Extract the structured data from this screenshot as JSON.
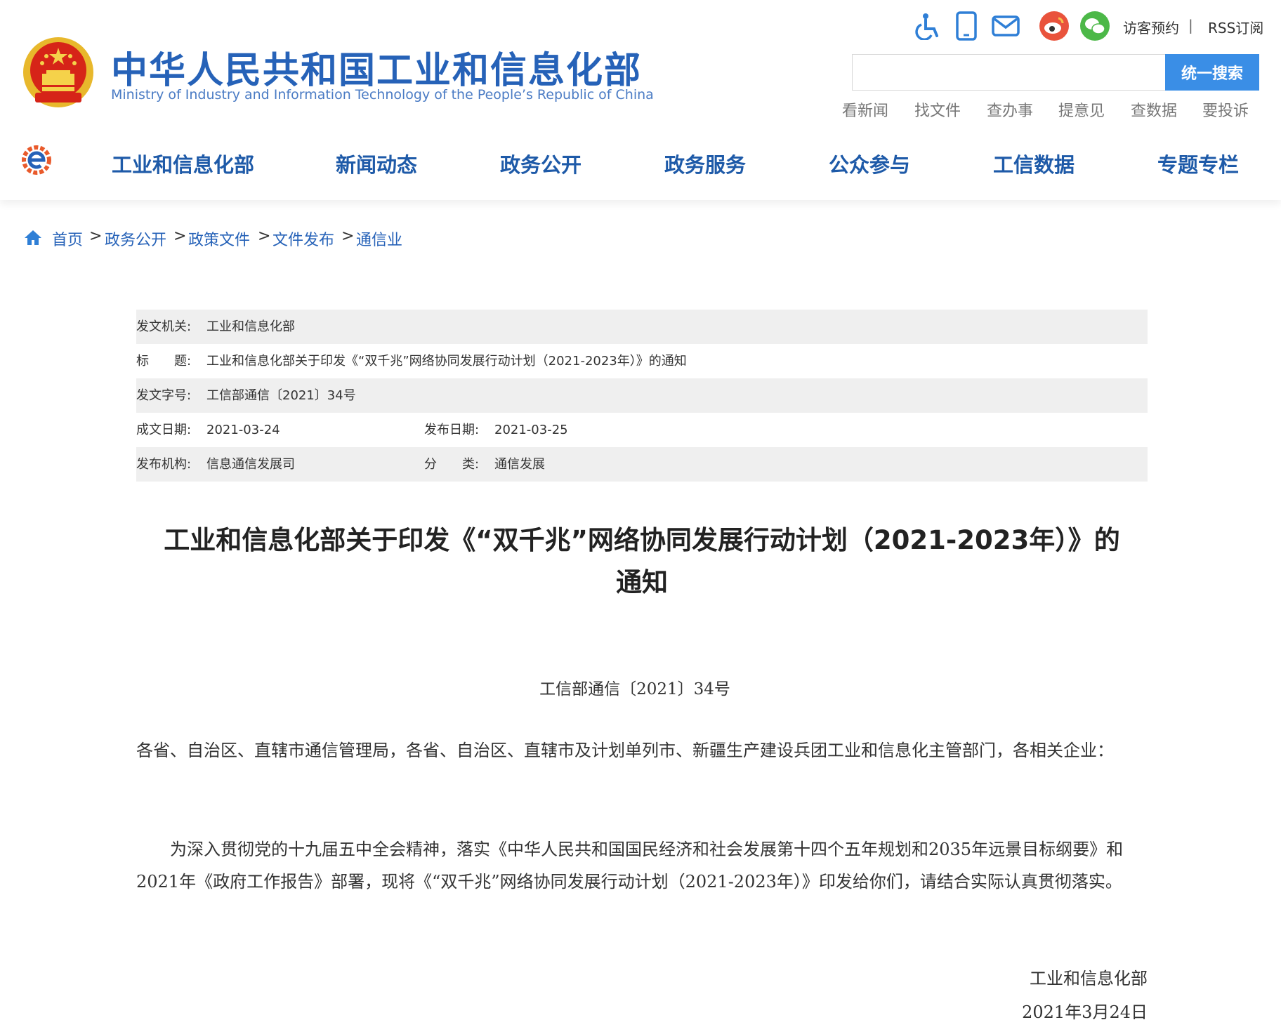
{
  "header": {
    "logo_cn": "中华人民共和国工业和信息化部",
    "logo_en": "Ministry of Industry and Information Technology of the People’s Republic of China",
    "top_links": {
      "visitor": "访客预约",
      "divider": "|",
      "rss": "RSS订阅"
    },
    "search": {
      "placeholder": "",
      "button": "统一搜索"
    },
    "quick_links": [
      "看新闻",
      "找文件",
      "查办事",
      "提意见",
      "查数据",
      "要投诉"
    ]
  },
  "nav": [
    "工业和信息化部",
    "新闻动态",
    "政务公开",
    "政务服务",
    "公众参与",
    "工信数据",
    "专题专栏"
  ],
  "breadcrumb": [
    "首页",
    "政务公开",
    "政策文件",
    "文件发布",
    "通信业"
  ],
  "meta": {
    "issuer_label": "发文机关:",
    "issuer": "工业和信息化部",
    "title_label": "标　　题:",
    "title": "工业和信息化部关于印发《“双千兆”网络协同发展行动计划（2021-2023年）》的通知",
    "docno_label": "发文字号:",
    "docno": "工信部通信〔2021〕34号",
    "written_label": "成文日期:",
    "written": "2021-03-24",
    "published_label": "发布日期:",
    "published": "2021-03-25",
    "org_label": "发布机构:",
    "org": "信息通信发展司",
    "category_label": "分　　类:",
    "category": "通信发展"
  },
  "document": {
    "title_line1": "工业和信息化部关于印发《“双千兆”网络协同发展行动计划（2021-2023年）》的",
    "title_line2": "通知",
    "number": "工信部通信〔2021〕34号",
    "addressee": "各省、自治区、直辖市通信管理局，各省、自治区、直辖市及计划单列市、新疆生产建设兵团工业和信息化主管部门，各相关企业：",
    "body": "为深入贯彻党的十九届五中全会精神，落实《中华人民共和国国民经济和社会发展第十四个五年规划和2035年远景目标纲要》和2021年《政府工作报告》部署，现将《“双千兆”网络协同发展行动计划（2021-2023年）》印发给你们，请结合实际认真贯彻落实。",
    "signature": "工业和信息化部",
    "date": "2021年3月24日"
  },
  "colors": {
    "brand": "#2662b8",
    "nav": "#1e5aa8",
    "search_button": "#3a8ee6",
    "meta_shade": "#efefef"
  },
  "icons": [
    "accessibility-icon",
    "mobile-icon",
    "mail-icon",
    "weibo-icon",
    "wechat-icon",
    "home-icon"
  ]
}
